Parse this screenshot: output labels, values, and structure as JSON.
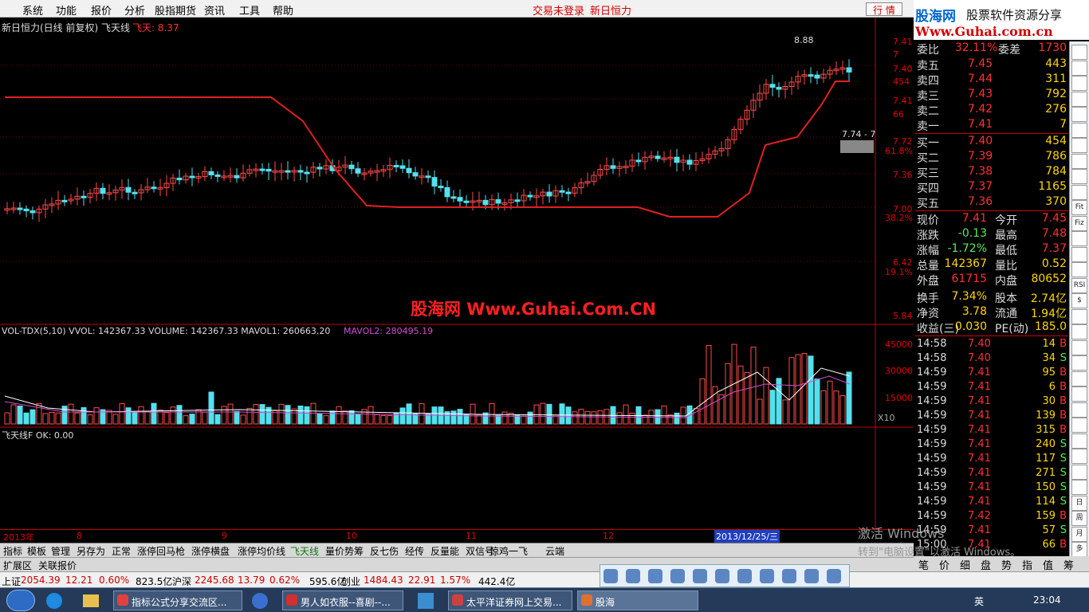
{
  "menu": [
    "系统",
    "功能",
    "报价",
    "分析",
    "股指期货",
    "资讯",
    "工具",
    "帮助"
  ],
  "menu_status": [
    "交易未登录",
    "新日恒力"
  ],
  "hq_button": "行 情",
  "logo": {
    "name": "股海网",
    "slogan": "股票软件资源分享",
    "url": "Www.Guhai.com.cn"
  },
  "chart_header": {
    "title": "新日恒力(日线 前复权) 飞天线",
    "indicator": "飞天: 8.37",
    "vol_legend": "VOL-TDX(5,10) VVOL: 142367.33 VOLUME: 142367.33 MAVOL1: 260663.20",
    "vol_legend2": "MAVOL2: 280495.19",
    "lower_legend": "飞天线F OK: 0.00",
    "peak_label": "8.88",
    "mid_label": "7.74 - 7",
    "vol_scale": "X10",
    "period_label": "日线",
    "date_cursor": "2013/12/25/三"
  },
  "price_axis": [
    "7.41",
    "7",
    "7.40",
    "454",
    "7.41",
    "66",
    "7.72",
    "61.8%",
    "7.36",
    "7.00",
    "38.2%",
    "6.42",
    "19.1%",
    "5.84"
  ],
  "vol_axis": [
    "45000",
    "30000",
    "15000"
  ],
  "x_axis": [
    "2013年",
    "8",
    "9",
    "10",
    "11",
    "12"
  ],
  "watermark_center": "股海网 Www.Guhai.Com.CN",
  "quote": {
    "weibi": {
      "label": "委比",
      "value": "32.11%",
      "label2": "委差",
      "value2": "1730"
    },
    "sell": [
      {
        "label": "卖五",
        "price": "7.45",
        "vol": "443"
      },
      {
        "label": "卖四",
        "price": "7.44",
        "vol": "311"
      },
      {
        "label": "卖三",
        "price": "7.43",
        "vol": "792"
      },
      {
        "label": "卖二",
        "price": "7.42",
        "vol": "276"
      },
      {
        "label": "卖一",
        "price": "7.41",
        "vol": "7"
      }
    ],
    "buy": [
      {
        "label": "买一",
        "price": "7.40",
        "vol": "454"
      },
      {
        "label": "买二",
        "price": "7.39",
        "vol": "786"
      },
      {
        "label": "买三",
        "price": "7.38",
        "vol": "784"
      },
      {
        "label": "买四",
        "price": "7.37",
        "vol": "1165"
      },
      {
        "label": "买五",
        "price": "7.36",
        "vol": "370"
      }
    ],
    "stats": [
      {
        "l1": "现价",
        "v1": "7.41",
        "l2": "今开",
        "v2": "7.45"
      },
      {
        "l1": "涨跌",
        "v1": "-0.13",
        "l2": "最高",
        "v2": "7.48"
      },
      {
        "l1": "涨幅",
        "v1": "-1.72%",
        "l2": "最低",
        "v2": "7.37"
      },
      {
        "l1": "总量",
        "v1": "142367",
        "l2": "量比",
        "v2": "0.52"
      },
      {
        "l1": "外盘",
        "v1": "61715",
        "l2": "内盘",
        "v2": "80652"
      },
      {
        "l1": "换手",
        "v1": "7.34%",
        "l2": "股本",
        "v2": "2.74亿"
      },
      {
        "l1": "净资",
        "v1": "3.78",
        "l2": "流通",
        "v2": "1.94亿"
      },
      {
        "l1": "收益(三)",
        "v1": "0.030",
        "l2": "PE(动)",
        "v2": "185.0"
      }
    ],
    "ticks": [
      [
        "14:58",
        "7.40",
        "14",
        "B"
      ],
      [
        "14:58",
        "7.40",
        "34",
        "S"
      ],
      [
        "14:59",
        "7.41",
        "95",
        "B"
      ],
      [
        "14:59",
        "7.41",
        "6",
        "B"
      ],
      [
        "14:59",
        "7.41",
        "30",
        "B"
      ],
      [
        "14:59",
        "7.41",
        "139",
        "B"
      ],
      [
        "14:59",
        "7.41",
        "315",
        "B"
      ],
      [
        "14:59",
        "7.41",
        "240",
        "S"
      ],
      [
        "14:59",
        "7.41",
        "117",
        "S"
      ],
      [
        "14:59",
        "7.41",
        "271",
        "S"
      ],
      [
        "14:59",
        "7.41",
        "150",
        "S"
      ],
      [
        "14:59",
        "7.41",
        "114",
        "S"
      ],
      [
        "14:59",
        "7.42",
        "159",
        "B"
      ],
      [
        "14:59",
        "7.41",
        "57",
        "S"
      ],
      [
        "15:00",
        "7.41",
        "66",
        "B"
      ]
    ]
  },
  "toolstrip": [
    "",
    "",
    "",
    "",
    "",
    "",
    "",
    "",
    "",
    "",
    "Fit",
    "Fiz",
    "",
    "",
    "",
    "RSI",
    "$",
    "",
    "",
    "",
    "",
    "",
    "",
    "",
    "",
    "",
    "",
    "",
    "",
    "日",
    "周",
    "月",
    "多"
  ],
  "bottom_tabs": [
    "扩展区",
    "关联报价"
  ],
  "formula_tabs": [
    "指标",
    "模板",
    "管理",
    "另存为",
    "正常",
    "涨停回马枪",
    "涨停横盘",
    "涨停均价线",
    "飞天线",
    "量价势筹",
    "反七伤",
    "经传",
    "反量能",
    "双信号",
    "惊鸡一飞",
    "云端"
  ],
  "right_tabs": [
    "笔",
    "价",
    "细",
    "盘",
    "势",
    "指",
    "值",
    "筹"
  ],
  "statusbar": [
    {
      "t": "上证",
      "c": "#000"
    },
    {
      "t": "2054.39",
      "c": "#c00"
    },
    {
      "t": "12.21",
      "c": "#c00"
    },
    {
      "t": "0.60%",
      "c": "#c00"
    },
    {
      "t": "823.5亿",
      "c": "#000"
    },
    {
      "t": "沪深",
      "c": "#000"
    },
    {
      "t": "2245.68",
      "c": "#c00"
    },
    {
      "t": "13.79",
      "c": "#c00"
    },
    {
      "t": "0.62%",
      "c": "#c00"
    },
    {
      "t": "595.6亿",
      "c": "#000"
    },
    {
      "t": "创业",
      "c": "#000"
    },
    {
      "t": "1484.43",
      "c": "#c00"
    },
    {
      "t": "22.91",
      "c": "#c00"
    },
    {
      "t": "1.57%",
      "c": "#c00"
    },
    {
      "t": "442.4亿",
      "c": "#000"
    }
  ],
  "watermark": [
    "激活 Windows",
    "转到\"电脑设置\"以激活 Windows。"
  ],
  "taskbar": [
    "指标公式分享交流区...",
    "男人如衣服--喜剧--...",
    "太平洋证券网上交易...",
    "股海"
  ],
  "clock": "23:04",
  "tray_lang": "英"
}
